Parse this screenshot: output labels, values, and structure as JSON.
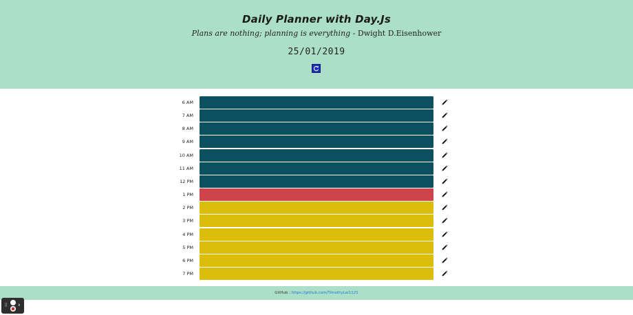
{
  "header": {
    "title": "Daily Planner with Day.Js",
    "quote_text": "Plans are nothing; planning is everything",
    "quote_author": " - Dwight D.Eisenhower",
    "date": "25/01/2019",
    "refresh_icon": "refresh-icon"
  },
  "planner": {
    "colors": {
      "past": "#0d5160",
      "present": "#cf434b",
      "future": "#dcbd0b"
    },
    "hours": [
      {
        "label": "6 AM",
        "state": "past"
      },
      {
        "label": "7 AM",
        "state": "past"
      },
      {
        "label": "8 AM",
        "state": "past"
      },
      {
        "label": "9 AM",
        "state": "past"
      },
      {
        "label": "10 AM",
        "state": "past"
      },
      {
        "label": "11 AM",
        "state": "past"
      },
      {
        "label": "12 PM",
        "state": "past"
      },
      {
        "label": "1 PM",
        "state": "present"
      },
      {
        "label": "2 PM",
        "state": "future"
      },
      {
        "label": "3 PM",
        "state": "future"
      },
      {
        "label": "4 PM",
        "state": "future"
      },
      {
        "label": "5 PM",
        "state": "future"
      },
      {
        "label": "6 PM",
        "state": "future"
      },
      {
        "label": "7 PM",
        "state": "future"
      }
    ],
    "edit_icon": "pencil-icon"
  },
  "footer": {
    "label": "GitHub : ",
    "link": "https://github.com/TimothyLai1121"
  },
  "widget": {
    "badge": "0"
  }
}
